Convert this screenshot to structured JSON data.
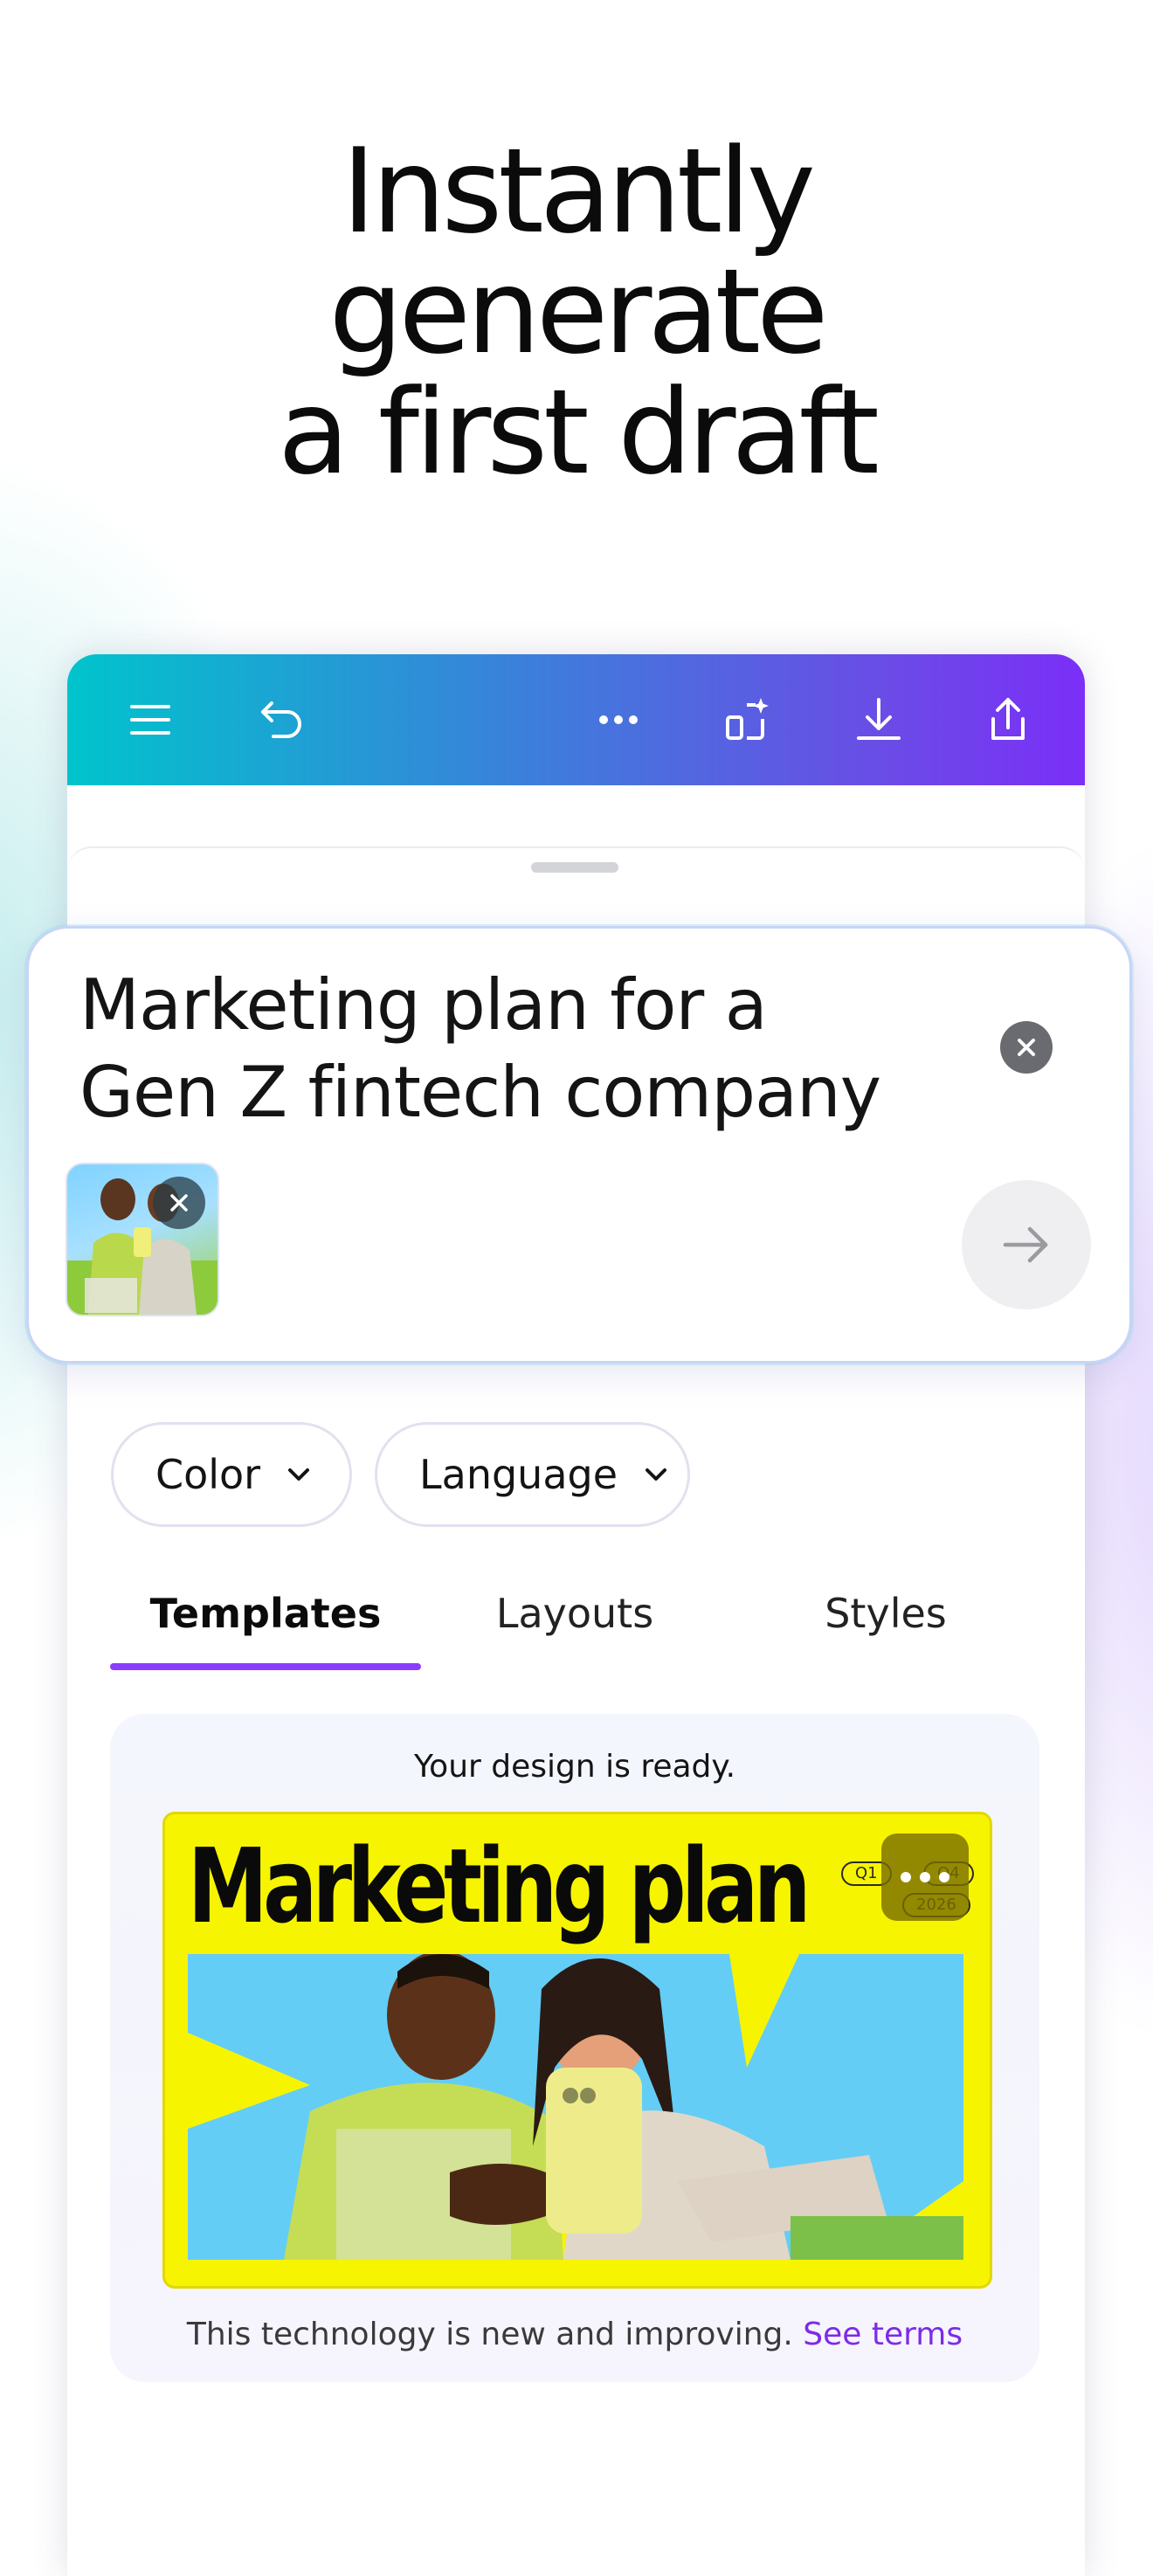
{
  "headline": {
    "line1": "Instantly",
    "line2": "generate",
    "line3": "a first draft"
  },
  "toolbar": {
    "icons": [
      "menu-icon",
      "undo-icon",
      "more-icon",
      "magic-resize-icon",
      "download-icon",
      "share-icon"
    ]
  },
  "prompt": {
    "text_line1": "Marketing plan for a",
    "text_line2": "Gen Z fintech company"
  },
  "filters": [
    {
      "label": "Color"
    },
    {
      "label": "Language"
    }
  ],
  "tabs": [
    {
      "label": "Templates",
      "active": true
    },
    {
      "label": "Layouts",
      "active": false
    },
    {
      "label": "Styles",
      "active": false
    }
  ],
  "result": {
    "status": "Your design is ready.",
    "design_title": "Marketing plan",
    "pills": [
      "Q1",
      "Q4",
      "2026"
    ],
    "footnote_text": "This technology is new and improving.",
    "footnote_link": "See terms"
  },
  "colors": {
    "accent": "#8b3dff",
    "toolbar_start": "#00c4cc",
    "toolbar_end": "#7b2ff7",
    "design_yellow": "#f7f400",
    "link": "#7d2ae8"
  }
}
